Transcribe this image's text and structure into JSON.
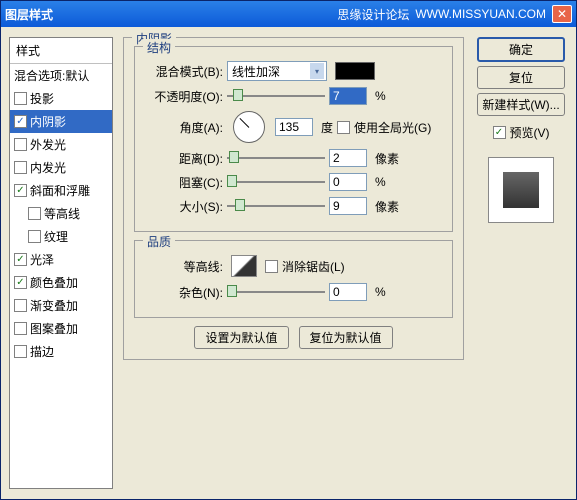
{
  "titlebar": {
    "title": "图层样式",
    "brand": "思缘设计论坛",
    "url": "WWW.MISSYUAN.COM"
  },
  "styles": {
    "header": "样式",
    "blend_defaults": "混合选项:默认",
    "items": [
      {
        "label": "投影",
        "checked": false
      },
      {
        "label": "内阴影",
        "checked": true,
        "selected": true
      },
      {
        "label": "外发光",
        "checked": false
      },
      {
        "label": "内发光",
        "checked": false
      },
      {
        "label": "斜面和浮雕",
        "checked": true
      },
      {
        "label": "等高线",
        "checked": false,
        "indent": true
      },
      {
        "label": "纹理",
        "checked": false,
        "indent": true
      },
      {
        "label": "光泽",
        "checked": true
      },
      {
        "label": "颜色叠加",
        "checked": true
      },
      {
        "label": "渐变叠加",
        "checked": false
      },
      {
        "label": "图案叠加",
        "checked": false
      },
      {
        "label": "描边",
        "checked": false
      }
    ]
  },
  "panel": {
    "title": "内阴影",
    "structure_title": "结构",
    "blend_mode_label": "混合模式(B):",
    "blend_mode_value": "线性加深",
    "opacity_label": "不透明度(O):",
    "opacity_value": "7",
    "opacity_unit": "%",
    "angle_label": "角度(A):",
    "angle_value": "135",
    "angle_unit": "度",
    "global_light_label": "使用全局光(G)",
    "distance_label": "距离(D):",
    "distance_value": "2",
    "distance_unit": "像素",
    "choke_label": "阻塞(C):",
    "choke_value": "0",
    "choke_unit": "%",
    "size_label": "大小(S):",
    "size_value": "9",
    "size_unit": "像素",
    "quality_title": "品质",
    "contour_label": "等高线:",
    "antialias_label": "消除锯齿(L)",
    "noise_label": "杂色(N):",
    "noise_value": "0",
    "noise_unit": "%",
    "set_default": "设置为默认值",
    "reset_default": "复位为默认值"
  },
  "right": {
    "ok": "确定",
    "reset": "复位",
    "new_style": "新建样式(W)...",
    "preview_label": "预览(V)"
  },
  "colors": {
    "swatch": "#000000"
  }
}
